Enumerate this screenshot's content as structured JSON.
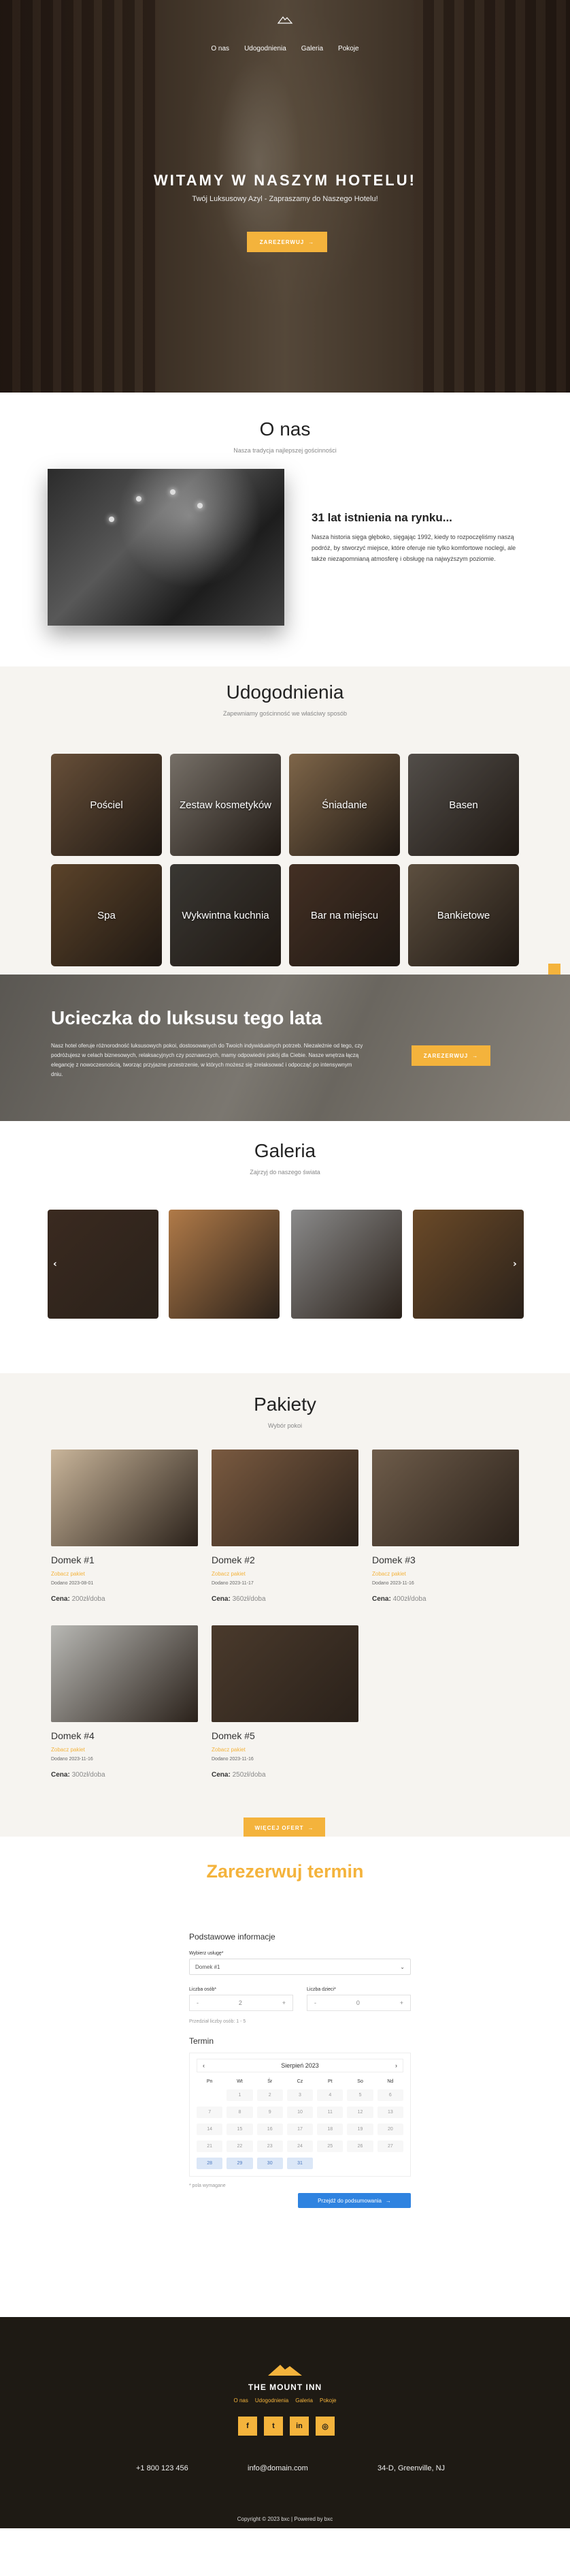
{
  "hero": {
    "nav": [
      "O nas",
      "Udogodnienia",
      "Galeria",
      "Pokoje"
    ],
    "title": "WITAMY W NASZYM HOTELU!",
    "subtitle": "Twój Luksusowy Azyl - Zapraszamy do Naszego Hotelu!",
    "button": "ZAREZERWUJ",
    "button_arrow": "→"
  },
  "onas": {
    "title": "O nas",
    "subtitle": "Nasza tradycja najlepszej gościnności",
    "heading": "31 lat istnienia na rynku...",
    "text": "Nasza historia sięga głęboko, sięgając 1992, kiedy to rozpoczęliśmy naszą podróż, by stworzyć miejsce, które oferuje nie tylko komfortowe noclegi, ale także niezapomnianą atmosferę i obsługę na najwyższym poziomie."
  },
  "udogodnienia": {
    "title": "Udogodnienia",
    "subtitle": "Zapewniamy gościnność we właściwy sposób",
    "items": [
      {
        "label": "Pościel",
        "color": "#8a6a4c"
      },
      {
        "label": "Zestaw kosmetyków",
        "color": "#9e958a"
      },
      {
        "label": "Śniadanie",
        "color": "#a98862"
      },
      {
        "label": "Basen",
        "color": "#6e6862"
      },
      {
        "label": "Spa",
        "color": "#7a5a38"
      },
      {
        "label": "Wykwintna kuchnia",
        "color": "#4d4a44"
      },
      {
        "label": "Bar na miejscu",
        "color": "#5a4030"
      },
      {
        "label": "Bankietowe",
        "color": "#7c6a55"
      }
    ]
  },
  "promo": {
    "title": "Ucieczka do luksusu tego lata",
    "text": "Nasz hotel oferuje różnorodność luksusowych pokoi, dostosowanych do Twoich indywidualnych potrzeb. Niezależnie od tego, czy podróżujesz w celach biznesowych, relaksacyjnych czy poznawczych, mamy odpowiedni pokój dla Ciebie. Nasze wnętrza łączą elegancję z nowoczesnością, tworząc przyjazne przestrzenie, w których możesz się zrelaksować i odpocząć po intensywnym dniu.",
    "button": "ZAREZERWUJ",
    "button_arrow": "→"
  },
  "galeria": {
    "title": "Galeria",
    "subtitle": "Zajrzyj do naszego świata",
    "prev": "‹",
    "next": "›",
    "images": [
      {
        "color": "#3a2a20"
      },
      {
        "color": "#b07a48"
      },
      {
        "color": "#8a8a8a"
      },
      {
        "color": "#6b4a28"
      }
    ]
  },
  "pakiety": {
    "title": "Pakiety",
    "subtitle": "Wybór pokoi",
    "price_label": "Cena:",
    "items": [
      {
        "name": "Domek #1",
        "link": "Zobacz pakiet",
        "date": "Dodano 2023-08-01",
        "price": "200zł/doba",
        "color": "#c9b59a"
      },
      {
        "name": "Domek #2",
        "link": "Zobacz pakiet",
        "date": "Dodano 2023-11-17",
        "price": "360zł/doba",
        "color": "#7a5a40"
      },
      {
        "name": "Domek #3",
        "link": "Zobacz pakiet",
        "date": "Dodano 2023-11-16",
        "price": "400zł/doba",
        "color": "#6e5c4a"
      },
      {
        "name": "Domek #4",
        "link": "Zobacz pakiet",
        "date": "Dodano 2023-11-16",
        "price": "300zł/doba",
        "color": "#b8b8b4"
      },
      {
        "name": "Domek #5",
        "link": "Zobacz pakiet",
        "date": "Dodano 2023-11-16",
        "price": "250zł/doba",
        "color": "#4a3a2c"
      }
    ],
    "more_button": "WIĘCEJ OFERT",
    "more_arrow": "→"
  },
  "rezerwacja": {
    "title": "Zarezerwuj termin",
    "section_basic": "Podstawowe informacje",
    "service_label": "Wybierz usługę*",
    "service_value": "Domek #1",
    "adults_label": "Liczba osób*",
    "adults_value": "2",
    "kids_label": "Liczba dzieci*",
    "kids_value": "0",
    "minus": "-",
    "plus": "+",
    "hint": "Przedział liczby osób: 1 - 5",
    "term_label": "Termin",
    "month": "Sierpień 2023",
    "prev_month": "‹",
    "next_month": "›",
    "dow": [
      "Pn",
      "Wt",
      "Śr",
      "Cz",
      "Pt",
      "So",
      "Nd"
    ],
    "days": [
      "",
      "1",
      "2",
      "3",
      "4",
      "5",
      "6",
      "7",
      "8",
      "9",
      "10",
      "11",
      "12",
      "13",
      "14",
      "15",
      "16",
      "17",
      "18",
      "19",
      "20",
      "21",
      "22",
      "23",
      "24",
      "25",
      "26",
      "27",
      "28",
      "29",
      "30",
      "31"
    ],
    "available_from": 28,
    "required_note": "* pola wymagane",
    "submit": "Przejdź do podsumowania",
    "submit_arrow": "→"
  },
  "footer": {
    "brand": "THE MOUNT INN",
    "nav": [
      "O nas",
      "Udogodnienia",
      "Galeria",
      "Pokoje"
    ],
    "social": [
      "f",
      "t",
      "in",
      "◎"
    ],
    "phone": "+1 800 123 456",
    "email": "info@domain.com",
    "address": "34-D, Greenville, NJ",
    "copyright": "Copyright © 2023 bxc | Powered by bxc"
  }
}
